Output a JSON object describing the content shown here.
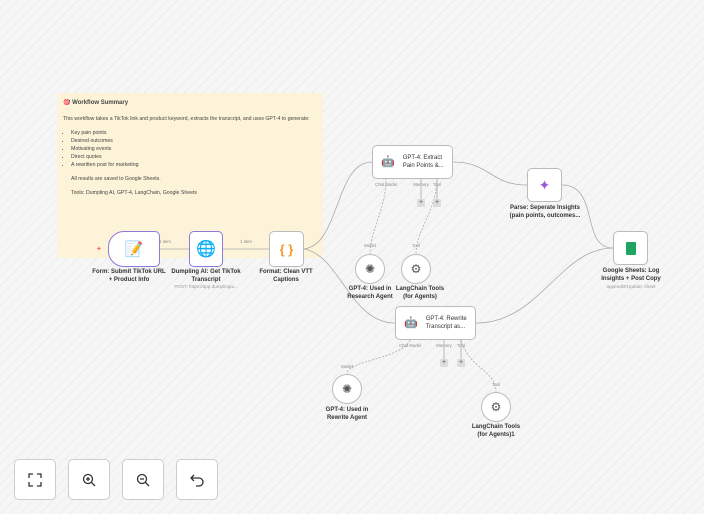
{
  "sticky": {
    "title": "Workflow Summary",
    "intro": "This workflow takes a TikTok link and product keyword, extracts the transcript, and uses GPT-4 to generate:",
    "bullets": [
      "Key pain points",
      "Desired outcomes",
      "Motivating events",
      "Direct quotes",
      "A rewritten post for marketing"
    ],
    "saved": "All results are saved to Google Sheets.",
    "tools": "Tools: Dumpling AI, GPT-4, LangChain, Google Sheets"
  },
  "nodes": {
    "form": {
      "label1": "Form: Submit TikTok URL",
      "label2": "+ Product Info"
    },
    "dumpling": {
      "label1": "Dumpling AI: Get TikTok",
      "label2": "Transcript",
      "sub": "POST: https://app.dumplingai..."
    },
    "format": {
      "label1": "Format: Clean VTT",
      "label2": "Captions"
    },
    "agent1": {
      "label1": "GPT-4: Extract",
      "label2": "Pain Points &..."
    },
    "parse": {
      "label1": "Parse: Seperate Insights",
      "label2": "(pain points, outcomes..."
    },
    "sheets": {
      "label1": "Google Sheets: Log",
      "label2": "Insights + Post Copy",
      "sub": "appendOrUpdate: sheet"
    },
    "model1": {
      "label1": "GPT-4: Used in",
      "label2": "Research Agent"
    },
    "tool1": {
      "label1": "LangChain Tools",
      "label2": "(for Agents)"
    },
    "agent2": {
      "label1": "GPT-4: Rewrite",
      "label2": "Transcript as..."
    },
    "model2": {
      "label1": "GPT-4: Used in",
      "label2": "Rewrite Agent"
    },
    "tool2": {
      "label1": "LangChain Tools",
      "label2": "(for Agents)1"
    }
  },
  "edges": {
    "item1": "1 item",
    "item2": "1 item"
  },
  "ports": {
    "chat": "Chat Model",
    "memory": "Memory",
    "tool": "Tool",
    "model": "Model"
  },
  "controls": [
    "fit-view",
    "zoom-in",
    "zoom-out",
    "undo"
  ],
  "colors": {
    "accent": "#8c7ad8",
    "sheets": "#1fa463",
    "code": "#f59a23"
  }
}
